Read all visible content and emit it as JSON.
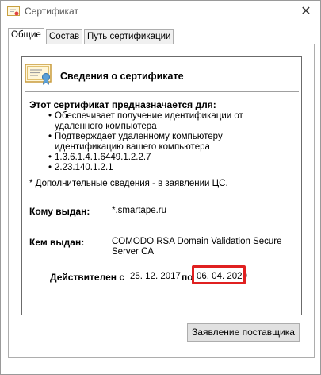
{
  "window": {
    "title": "Сертификат",
    "close_glyph": "✕"
  },
  "tabs": [
    {
      "label": "Общие",
      "active": true
    },
    {
      "label": "Состав",
      "active": false
    },
    {
      "label": "Путь сертификации",
      "active": false
    }
  ],
  "certificate": {
    "heading": "Сведения о сертификате",
    "purpose_title": "Этот сертификат предназначается для:",
    "purposes": [
      "Обеспечивает получение идентификации от удаленного компьютера",
      "Подтверждает удаленному компьютеру идентификацию вашего компьютера",
      "1.3.6.1.4.1.6449.1.2.2.7",
      "2.23.140.1.2.1"
    ],
    "footnote": "* Дополнительные сведения - в заявлении ЦС.",
    "issued_to_label": "Кому выдан:",
    "issued_to_value": "*.smartape.ru",
    "issued_by_label": "Кем выдан:",
    "issued_by_value": "COMODO RSA Domain Validation Secure Server CA",
    "valid_from_label": "Действителен с",
    "valid_from_value": "25. 12. 2017",
    "valid_to_label": "по",
    "valid_to_value": "06. 04. 2020"
  },
  "buttons": {
    "issuer_statement": "Заявление поставщика"
  },
  "colors": {
    "highlight": "#e02020",
    "button_bg": "#e1e1e1"
  }
}
